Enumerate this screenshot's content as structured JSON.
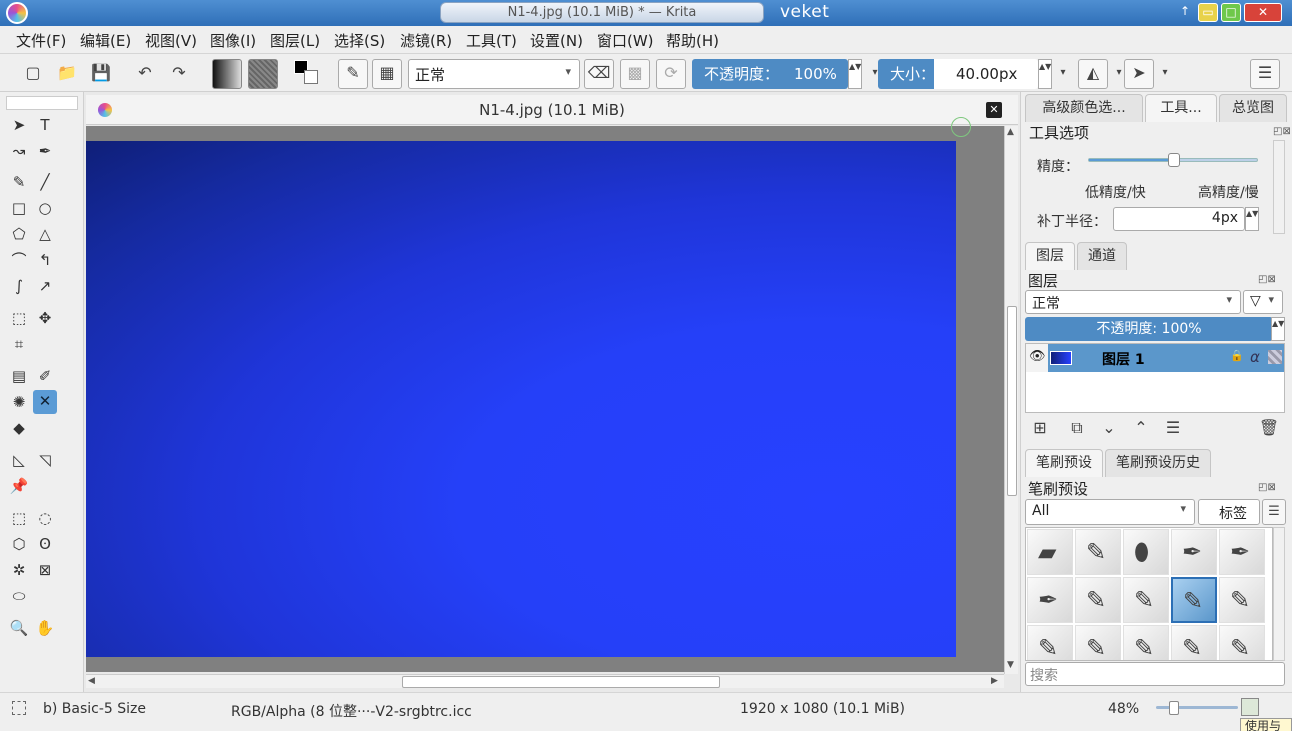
{
  "window": {
    "title": "N1-4.jpg (10.1 MiB) * — Krita",
    "user": "veket",
    "up_glyph": "↑",
    "minimize_glyph": "▭",
    "maximize_glyph": "□",
    "close_glyph": "✕"
  },
  "menu": [
    {
      "label": "文件(F)"
    },
    {
      "label": "编辑(E)"
    },
    {
      "label": "视图(V)"
    },
    {
      "label": "图像(I)"
    },
    {
      "label": "图层(L)"
    },
    {
      "label": "选择(S)"
    },
    {
      "label": "滤镜(R)"
    },
    {
      "label": "工具(T)"
    },
    {
      "label": "设置(N)"
    },
    {
      "label": "窗口(W)"
    },
    {
      "label": "帮助(H)"
    }
  ],
  "toolbar": {
    "blend_mode": "正常",
    "opacity_label": "不透明度：",
    "opacity_value": "100%",
    "size_label": "大小：",
    "size_value": "40.00px",
    "glyphs": {
      "new": "▢",
      "open": "📁",
      "save": "💾",
      "undo": "↶",
      "redo": "↷",
      "brush_editor": "✎",
      "presets": "▦",
      "eraser": "⌫",
      "alpha_lock": "▩",
      "reload": "⟳",
      "spinner": "▲▼",
      "dropdown": "▾",
      "mirror_h": "◭",
      "mirror_v": "➤",
      "settings": "☰"
    }
  },
  "tools": {
    "select": "➤",
    "text": "T",
    "freehand-path": "↝",
    "bezier": "✒",
    "brush": "✎",
    "line": "╱",
    "rectangle": "□",
    "ellipse": "○",
    "polygon": "⬠",
    "polyline": "△",
    "bezier-curve": "⌒",
    "freehand-select": "↰",
    "dynamic-brush": "∫",
    "multibrush": "↗",
    "transform": "⬚",
    "move": "✥",
    "crop": "⌗",
    "gradient": "▤",
    "color-picker": "✐",
    "smart-patch": "✺",
    "assistant": "✕",
    "fill": "◆",
    "measure": "◺",
    "reference": "◹",
    "pin": "📌",
    "rect-select": "⬚",
    "ellipse-select": "◌",
    "polygon-select": "⬡",
    "freehand-lasso": "ʘ",
    "magic-wand": "✲",
    "similar-select": "⊠",
    "bezier-select": "⬭",
    "zoom": "🔍",
    "pan": "✋"
  },
  "document": {
    "tab_title": "N1-4.jpg (10.1 MiB)",
    "close_glyph": "✕",
    "scroll_up": "▲",
    "scroll_down": "▼",
    "scroll_left": "◀",
    "scroll_right": "▶"
  },
  "dock": {
    "top_tabs": [
      {
        "label": "高级颜色选..."
      },
      {
        "label": "工具..."
      },
      {
        "label": "总览图"
      }
    ],
    "tool_options": {
      "title": "工具选项",
      "precision_label": "精度：",
      "precision_value": 0.5,
      "low_label": "低精度/快",
      "high_label": "高精度/慢",
      "patch_radius_label": "补丁半径：",
      "patch_radius_value": "4px"
    },
    "layer_tabs": [
      {
        "label": "图层"
      },
      {
        "label": "通道"
      }
    ],
    "layers": {
      "title": "图层",
      "blend_mode": "正常",
      "filter_glyph": "▽",
      "opacity_text": "不透明度:  100%",
      "items": [
        {
          "name": "图层 1",
          "visible_glyph": "👁",
          "lock_glyph": "🔒",
          "alpha_glyph": "α"
        }
      ],
      "actions": {
        "add": "⊞",
        "duplicate": "⧉",
        "move_down": "⌄",
        "move_up": "⌃",
        "properties": "☰",
        "delete": "🗑"
      }
    },
    "brush_tabs": [
      {
        "label": "笔刷预设"
      },
      {
        "label": "笔刷预设历史"
      }
    ],
    "brush_presets": {
      "title": "笔刷预设",
      "filter_value": "All",
      "tag_label": "标签",
      "search_placeholder": "搜索",
      "brushes": [
        "▰",
        "✎",
        "⬮",
        "✒",
        "✒",
        "✒",
        "✎",
        "✎",
        "✎",
        "✎",
        "✎",
        "✎",
        "✎",
        "✎",
        "✎"
      ],
      "selected_index": 8
    },
    "panel_glyphs": "◰⊠"
  },
  "status": {
    "brush_name": "b) Basic-5 Size",
    "color_profile": "RGB/Alpha (8 位整···-V2-srgbtrc.icc",
    "image_size": "1920 x 1080 (10.1 MiB)",
    "zoom": "48%",
    "zoom_value": 0.22,
    "tooltip": "使用与"
  }
}
